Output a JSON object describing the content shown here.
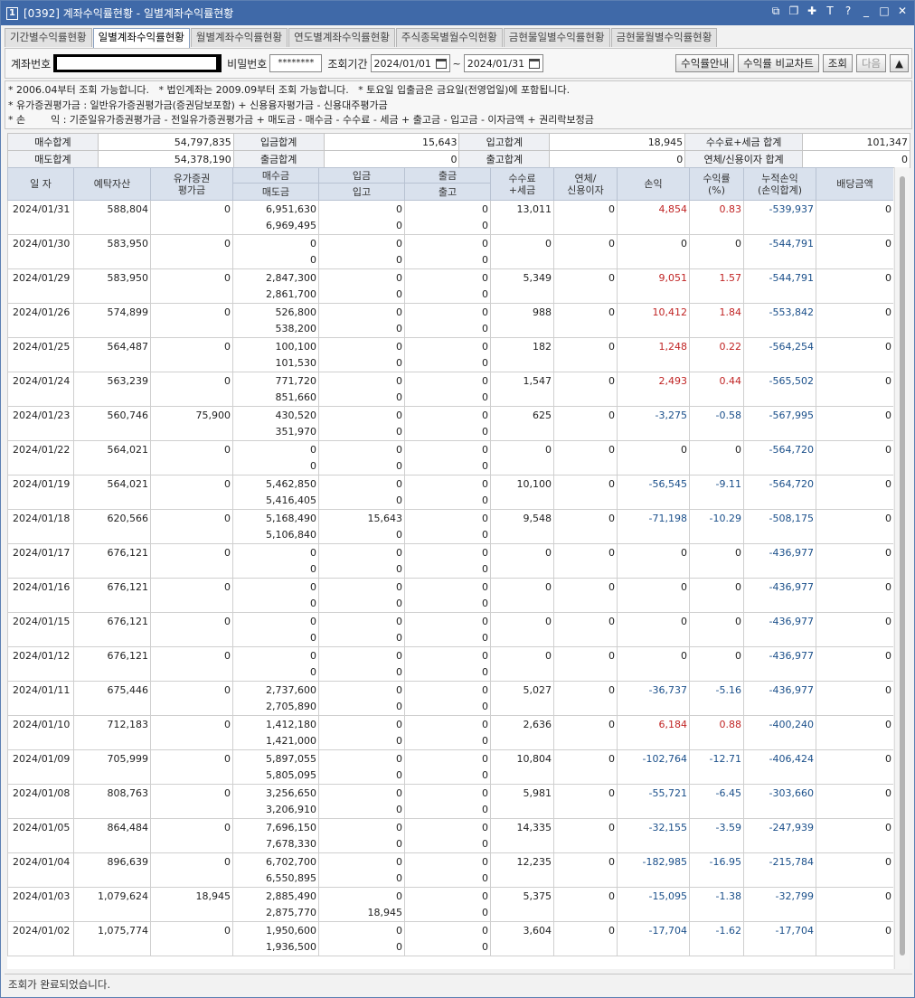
{
  "window": {
    "number": "1",
    "title": "[0392] 계좌수익률현황 - 일별계좌수익률현황"
  },
  "tabs": [
    "기간별수익률현황",
    "일별계좌수익률현황",
    "월별계좌수익률현황",
    "연도별계좌수익률현황",
    "주식종목별월수익현황",
    "금현물일별수익률현황",
    "금현물월별수익률현황"
  ],
  "query": {
    "account_label": "계좌번호",
    "password_label": "비밀번호",
    "password_value": "********",
    "period_label": "조회기간",
    "start_date": "2024/01/01",
    "tilde": "~",
    "end_date": "2024/01/31",
    "btn_guide": "수익률안내",
    "btn_chart": "수익률 비교차트",
    "btn_search": "조회",
    "btn_next": "다음",
    "btn_up": "▲"
  },
  "notes": [
    "* 2006.04부터 조회 가능합니다.   * 법인계좌는 2009.09부터 조회 가능합니다.   * 토요일 입출금은 금요일(전영업일)에 포함됩니다.",
    "* 유가증권평가금 : 일반유가증권평가금(증권담보포함) + 신용융자평가금 - 신용대주평가금",
    "* 손        익 : 기준일유가증권평가금 - 전일유가증권평가금 + 매도금 - 매수금 - 수수료 - 세금 + 출고금 - 입고금 - 이자금액 + 권리락보정금"
  ],
  "summary": {
    "buy_total_label": "매수합계",
    "buy_total": "54,797,835",
    "deposit_total_label": "입금합계",
    "deposit_total": "15,643",
    "in_total_label": "입고합계",
    "in_total": "18,945",
    "fee_total_label": "수수료+세금 합계",
    "fee_total": "101,347",
    "sell_total_label": "매도합계",
    "sell_total": "54,378,190",
    "withdraw_total_label": "출금합계",
    "withdraw_total": "0",
    "out_total_label": "출고합계",
    "out_total": "0",
    "interest_total_label": "연체/신용이자 합계",
    "interest_total": "0"
  },
  "headers": {
    "date": "일 자",
    "deposit_asset": "예탁자산",
    "sec_eval_1": "유가증권",
    "sec_eval_2": "평가금",
    "buy": "매수금",
    "sell": "매도금",
    "dep": "입금",
    "in": "입고",
    "wd": "출금",
    "out": "출고",
    "fee_1": "수수료",
    "fee_2": "+세금",
    "int_1": "연체/",
    "int_2": "신용이자",
    "pl": "손익",
    "rate_1": "수익률",
    "rate_2": "(%)",
    "cum_1": "누적손익",
    "cum_2": "(손익합계)",
    "div": "배당금액"
  },
  "rows": [
    {
      "date": "2024/01/31",
      "asset": "588,804",
      "sec": "0",
      "buy": "6,951,630",
      "sell": "6,969,495",
      "dep": "0",
      "in": "0",
      "wd": "0",
      "out": "0",
      "fee": "13,011",
      "int": "0",
      "pl": "4,854",
      "rate": "0.83",
      "cum": "-539,937",
      "div": "0",
      "sign": "pos"
    },
    {
      "date": "2024/01/30",
      "asset": "583,950",
      "sec": "0",
      "buy": "0",
      "sell": "0",
      "dep": "0",
      "in": "0",
      "wd": "0",
      "out": "0",
      "fee": "0",
      "int": "0",
      "pl": "0",
      "rate": "0",
      "cum": "-544,791",
      "div": "0",
      "sign": "zero"
    },
    {
      "date": "2024/01/29",
      "asset": "583,950",
      "sec": "0",
      "buy": "2,847,300",
      "sell": "2,861,700",
      "dep": "0",
      "in": "0",
      "wd": "0",
      "out": "0",
      "fee": "5,349",
      "int": "0",
      "pl": "9,051",
      "rate": "1.57",
      "cum": "-544,791",
      "div": "0",
      "sign": "pos"
    },
    {
      "date": "2024/01/26",
      "asset": "574,899",
      "sec": "0",
      "buy": "526,800",
      "sell": "538,200",
      "dep": "0",
      "in": "0",
      "wd": "0",
      "out": "0",
      "fee": "988",
      "int": "0",
      "pl": "10,412",
      "rate": "1.84",
      "cum": "-553,842",
      "div": "0",
      "sign": "pos"
    },
    {
      "date": "2024/01/25",
      "asset": "564,487",
      "sec": "0",
      "buy": "100,100",
      "sell": "101,530",
      "dep": "0",
      "in": "0",
      "wd": "0",
      "out": "0",
      "fee": "182",
      "int": "0",
      "pl": "1,248",
      "rate": "0.22",
      "cum": "-564,254",
      "div": "0",
      "sign": "pos"
    },
    {
      "date": "2024/01/24",
      "asset": "563,239",
      "sec": "0",
      "buy": "771,720",
      "sell": "851,660",
      "dep": "0",
      "in": "0",
      "wd": "0",
      "out": "0",
      "fee": "1,547",
      "int": "0",
      "pl": "2,493",
      "rate": "0.44",
      "cum": "-565,502",
      "div": "0",
      "sign": "pos"
    },
    {
      "date": "2024/01/23",
      "asset": "560,746",
      "sec": "75,900",
      "buy": "430,520",
      "sell": "351,970",
      "dep": "0",
      "in": "0",
      "wd": "0",
      "out": "0",
      "fee": "625",
      "int": "0",
      "pl": "-3,275",
      "rate": "-0.58",
      "cum": "-567,995",
      "div": "0",
      "sign": "neg"
    },
    {
      "date": "2024/01/22",
      "asset": "564,021",
      "sec": "0",
      "buy": "0",
      "sell": "0",
      "dep": "0",
      "in": "0",
      "wd": "0",
      "out": "0",
      "fee": "0",
      "int": "0",
      "pl": "0",
      "rate": "0",
      "cum": "-564,720",
      "div": "0",
      "sign": "zero"
    },
    {
      "date": "2024/01/19",
      "asset": "564,021",
      "sec": "0",
      "buy": "5,462,850",
      "sell": "5,416,405",
      "dep": "0",
      "in": "0",
      "wd": "0",
      "out": "0",
      "fee": "10,100",
      "int": "0",
      "pl": "-56,545",
      "rate": "-9.11",
      "cum": "-564,720",
      "div": "0",
      "sign": "neg"
    },
    {
      "date": "2024/01/18",
      "asset": "620,566",
      "sec": "0",
      "buy": "5,168,490",
      "sell": "5,106,840",
      "dep": "15,643",
      "in": "0",
      "wd": "0",
      "out": "0",
      "fee": "9,548",
      "int": "0",
      "pl": "-71,198",
      "rate": "-10.29",
      "cum": "-508,175",
      "div": "0",
      "sign": "neg"
    },
    {
      "date": "2024/01/17",
      "asset": "676,121",
      "sec": "0",
      "buy": "0",
      "sell": "0",
      "dep": "0",
      "in": "0",
      "wd": "0",
      "out": "0",
      "fee": "0",
      "int": "0",
      "pl": "0",
      "rate": "0",
      "cum": "-436,977",
      "div": "0",
      "sign": "zero"
    },
    {
      "date": "2024/01/16",
      "asset": "676,121",
      "sec": "0",
      "buy": "0",
      "sell": "0",
      "dep": "0",
      "in": "0",
      "wd": "0",
      "out": "0",
      "fee": "0",
      "int": "0",
      "pl": "0",
      "rate": "0",
      "cum": "-436,977",
      "div": "0",
      "sign": "zero"
    },
    {
      "date": "2024/01/15",
      "asset": "676,121",
      "sec": "0",
      "buy": "0",
      "sell": "0",
      "dep": "0",
      "in": "0",
      "wd": "0",
      "out": "0",
      "fee": "0",
      "int": "0",
      "pl": "0",
      "rate": "0",
      "cum": "-436,977",
      "div": "0",
      "sign": "zero"
    },
    {
      "date": "2024/01/12",
      "asset": "676,121",
      "sec": "0",
      "buy": "0",
      "sell": "0",
      "dep": "0",
      "in": "0",
      "wd": "0",
      "out": "0",
      "fee": "0",
      "int": "0",
      "pl": "0",
      "rate": "0",
      "cum": "-436,977",
      "div": "0",
      "sign": "zero"
    },
    {
      "date": "2024/01/11",
      "asset": "675,446",
      "sec": "0",
      "buy": "2,737,600",
      "sell": "2,705,890",
      "dep": "0",
      "in": "0",
      "wd": "0",
      "out": "0",
      "fee": "5,027",
      "int": "0",
      "pl": "-36,737",
      "rate": "-5.16",
      "cum": "-436,977",
      "div": "0",
      "sign": "neg"
    },
    {
      "date": "2024/01/10",
      "asset": "712,183",
      "sec": "0",
      "buy": "1,412,180",
      "sell": "1,421,000",
      "dep": "0",
      "in": "0",
      "wd": "0",
      "out": "0",
      "fee": "2,636",
      "int": "0",
      "pl": "6,184",
      "rate": "0.88",
      "cum": "-400,240",
      "div": "0",
      "sign": "pos"
    },
    {
      "date": "2024/01/09",
      "asset": "705,999",
      "sec": "0",
      "buy": "5,897,055",
      "sell": "5,805,095",
      "dep": "0",
      "in": "0",
      "wd": "0",
      "out": "0",
      "fee": "10,804",
      "int": "0",
      "pl": "-102,764",
      "rate": "-12.71",
      "cum": "-406,424",
      "div": "0",
      "sign": "neg"
    },
    {
      "date": "2024/01/08",
      "asset": "808,763",
      "sec": "0",
      "buy": "3,256,650",
      "sell": "3,206,910",
      "dep": "0",
      "in": "0",
      "wd": "0",
      "out": "0",
      "fee": "5,981",
      "int": "0",
      "pl": "-55,721",
      "rate": "-6.45",
      "cum": "-303,660",
      "div": "0",
      "sign": "neg"
    },
    {
      "date": "2024/01/05",
      "asset": "864,484",
      "sec": "0",
      "buy": "7,696,150",
      "sell": "7,678,330",
      "dep": "0",
      "in": "0",
      "wd": "0",
      "out": "0",
      "fee": "14,335",
      "int": "0",
      "pl": "-32,155",
      "rate": "-3.59",
      "cum": "-247,939",
      "div": "0",
      "sign": "neg"
    },
    {
      "date": "2024/01/04",
      "asset": "896,639",
      "sec": "0",
      "buy": "6,702,700",
      "sell": "6,550,895",
      "dep": "0",
      "in": "0",
      "wd": "0",
      "out": "0",
      "fee": "12,235",
      "int": "0",
      "pl": "-182,985",
      "rate": "-16.95",
      "cum": "-215,784",
      "div": "0",
      "sign": "neg"
    },
    {
      "date": "2024/01/03",
      "asset": "1,079,624",
      "sec": "18,945",
      "buy": "2,885,490",
      "sell": "2,875,770",
      "dep": "0",
      "in": "18,945",
      "wd": "0",
      "out": "0",
      "fee": "5,375",
      "int": "0",
      "pl": "-15,095",
      "rate": "-1.38",
      "cum": "-32,799",
      "div": "0",
      "sign": "neg"
    },
    {
      "date": "2024/01/02",
      "asset": "1,075,774",
      "sec": "0",
      "buy": "1,950,600",
      "sell": "1,936,500",
      "dep": "0",
      "in": "0",
      "wd": "0",
      "out": "0",
      "fee": "3,604",
      "int": "0",
      "pl": "-17,704",
      "rate": "-1.62",
      "cum": "-17,704",
      "div": "0",
      "sign": "neg"
    }
  ],
  "status_text": "조회가 완료되었습니다.",
  "colors": {
    "title_bar": "#3f69a8",
    "header_bg": "#d9e1ed",
    "positive": "#c02424",
    "negative": "#1a4f8a"
  },
  "icons": [
    "window-number-icon",
    "restore-icon",
    "new-window-icon",
    "pin-icon",
    "font-icon",
    "help-icon",
    "minimize-icon",
    "maximize-icon",
    "close-icon",
    "calendar-icon",
    "scroll-up-icon"
  ]
}
